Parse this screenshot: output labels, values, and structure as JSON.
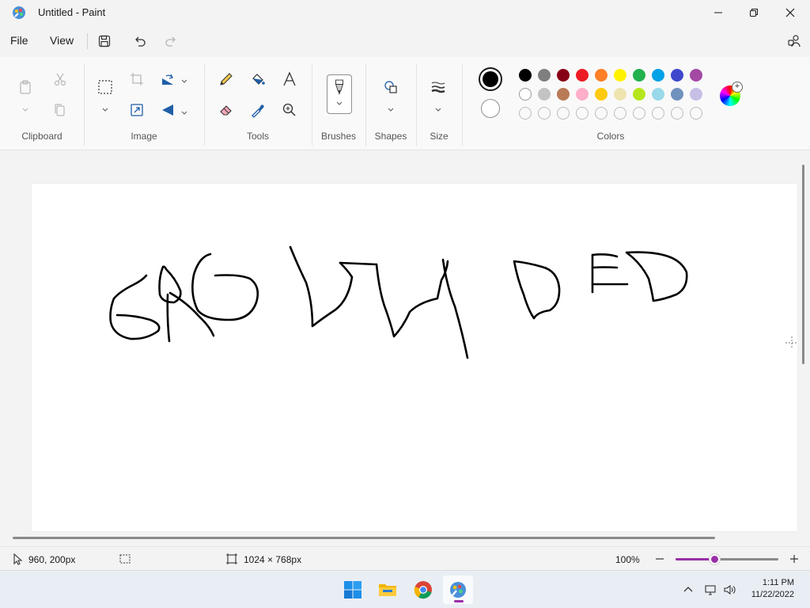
{
  "window": {
    "title": "Untitled - Paint",
    "controls": {
      "minimize": "minimize",
      "maximize": "restore",
      "close": "close"
    }
  },
  "menu": {
    "file": "File",
    "view": "View"
  },
  "ribbon": {
    "groups": {
      "clipboard": "Clipboard",
      "image": "Image",
      "tools": "Tools",
      "brushes": "Brushes",
      "shapes": "Shapes",
      "size": "Size",
      "colors": "Colors"
    },
    "colors": {
      "primary": "#000000",
      "secondary": "#ffffff",
      "row1": [
        "#000000",
        "#7f7f7f",
        "#880015",
        "#ed1c24",
        "#ff7f27",
        "#fff200",
        "#22b14c",
        "#00a2e8",
        "#3f48cc",
        "#a349a4"
      ],
      "row2": [
        "#ffffff",
        "#c3c3c3",
        "#b97a57",
        "#ffaec9",
        "#ffc90e",
        "#efe4b0",
        "#b5e61d",
        "#99d9ea",
        "#7092be",
        "#c8bfe7"
      ],
      "row3_empty_count": 10
    }
  },
  "status": {
    "cursor_position": "960, 200px",
    "canvas_size": "1024 × 768px",
    "zoom": "100%",
    "zoom_fraction": 0.38
  },
  "taskbar": {
    "time": "1:11 PM",
    "date": "11/22/2022",
    "apps": [
      "start-icon",
      "file-explorer-icon",
      "chrome-icon",
      "paint-icon"
    ]
  },
  "theme": {
    "accent": "#9a2fa8"
  }
}
